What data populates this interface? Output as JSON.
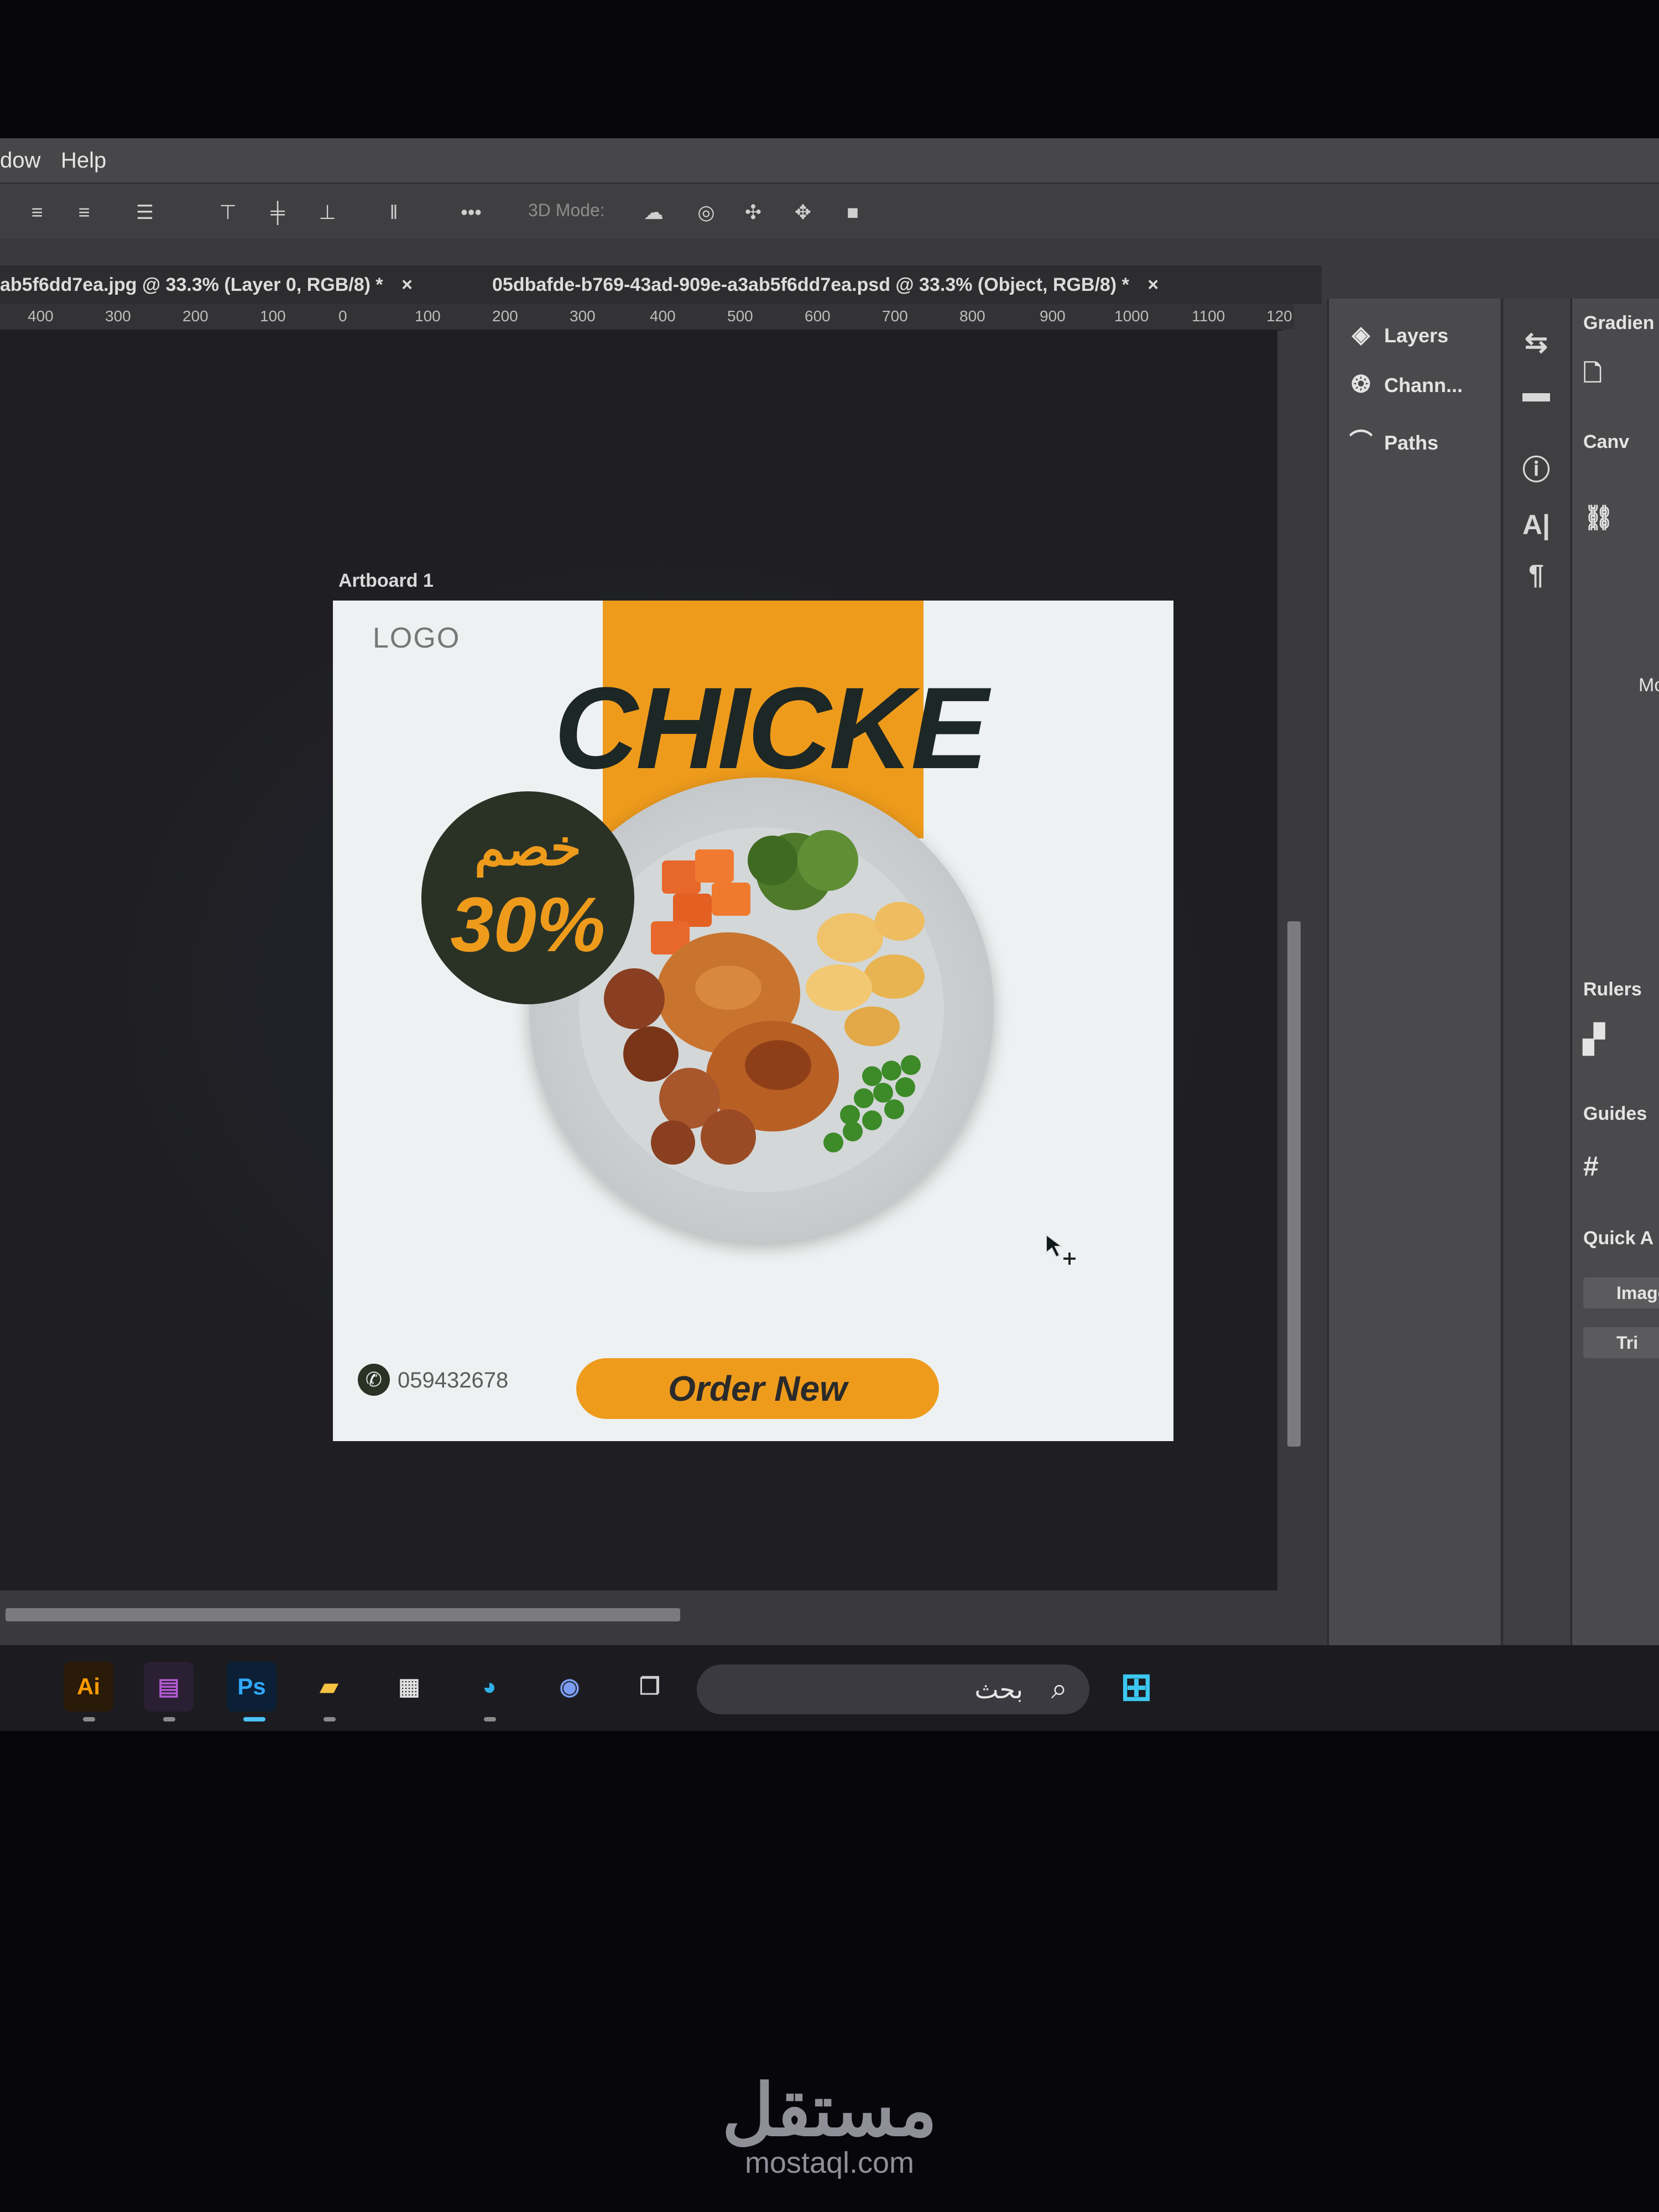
{
  "menu": {
    "window_partial": "dow",
    "help": "Help"
  },
  "options_bar": {
    "mode_3d_label": "3D Mode:"
  },
  "tabs": [
    {
      "label": "ab5f6dd7ea.jpg @ 33.3% (Layer 0, RGB/8) *"
    },
    {
      "label": "05dbafde-b769-43ad-909e-a3ab5f6dd7ea.psd @ 33.3% (Object, RGB/8) *"
    }
  ],
  "ruler": {
    "ticks": [
      "400",
      "300",
      "200",
      "100",
      "0",
      "100",
      "200",
      "300",
      "400",
      "500",
      "600",
      "700",
      "800",
      "900",
      "1000",
      "1100",
      "120"
    ]
  },
  "artboard": {
    "label": "Artboard 1",
    "logo": "LOGO",
    "headline": "CHICKE",
    "badge_arabic": "خصم",
    "badge_percent": "30%",
    "phone": "059432678",
    "order_button": "Order New",
    "accent_color": "#ee9b1c",
    "dark_color": "#2a3226"
  },
  "panels": {
    "layers": "Layers",
    "channels": "Chann...",
    "paths": "Paths",
    "properties_tab": "Gradien",
    "canvas_section": "Canv",
    "rulers_section": "Rulers",
    "guides_section": "Guides",
    "quick_actions_section": "Quick A",
    "image_button": "Image",
    "trim_button": "Tri",
    "mode_label": "Mo"
  },
  "taskbar": {
    "search_placeholder": "بحث",
    "apps": [
      "illustrator-icon",
      "winrar-icon",
      "photoshop-icon",
      "file-explorer-icon",
      "store-icon",
      "edge-icon",
      "chat-icon",
      "desktop-icon"
    ]
  },
  "watermark": {
    "arabic": "مستقل",
    "latin": "mostaql.com"
  }
}
